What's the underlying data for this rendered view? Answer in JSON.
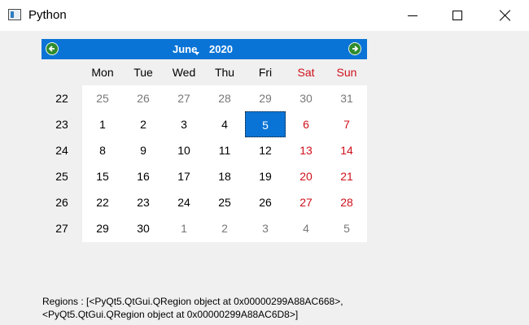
{
  "window": {
    "title": "Python"
  },
  "calendar": {
    "month": "June",
    "year": "2020",
    "weekdays": [
      {
        "label": "Mon",
        "weekend": false
      },
      {
        "label": "Tue",
        "weekend": false
      },
      {
        "label": "Wed",
        "weekend": false
      },
      {
        "label": "Thu",
        "weekend": false
      },
      {
        "label": "Fri",
        "weekend": false
      },
      {
        "label": "Sat",
        "weekend": true
      },
      {
        "label": "Sun",
        "weekend": true
      }
    ],
    "week_numbers": [
      "22",
      "23",
      "24",
      "25",
      "26",
      "27"
    ],
    "days": [
      [
        "25",
        "26",
        "27",
        "28",
        "29",
        "30",
        "31"
      ],
      [
        "1",
        "2",
        "3",
        "4",
        "5",
        "6",
        "7"
      ],
      [
        "8",
        "9",
        "10",
        "11",
        "12",
        "13",
        "14"
      ],
      [
        "15",
        "16",
        "17",
        "18",
        "19",
        "20",
        "21"
      ],
      [
        "22",
        "23",
        "24",
        "25",
        "26",
        "27",
        "28"
      ],
      [
        "29",
        "30",
        "1",
        "2",
        "3",
        "4",
        "5"
      ]
    ],
    "selected_day": "5",
    "colors": {
      "header": "#0a74d6",
      "weekend": "#d0101b",
      "other_month": "#787878",
      "selected": "#0a74d6"
    },
    "icons": {
      "prev": "prev-month-arrow-icon",
      "next": "next-month-arrow-icon"
    }
  },
  "regions": {
    "line1": "Regions : [<PyQt5.QtGui.QRegion object at 0x00000299A88AC668>,",
    "line2": "<PyQt5.QtGui.QRegion object at 0x00000299A88AC6D8>]"
  }
}
